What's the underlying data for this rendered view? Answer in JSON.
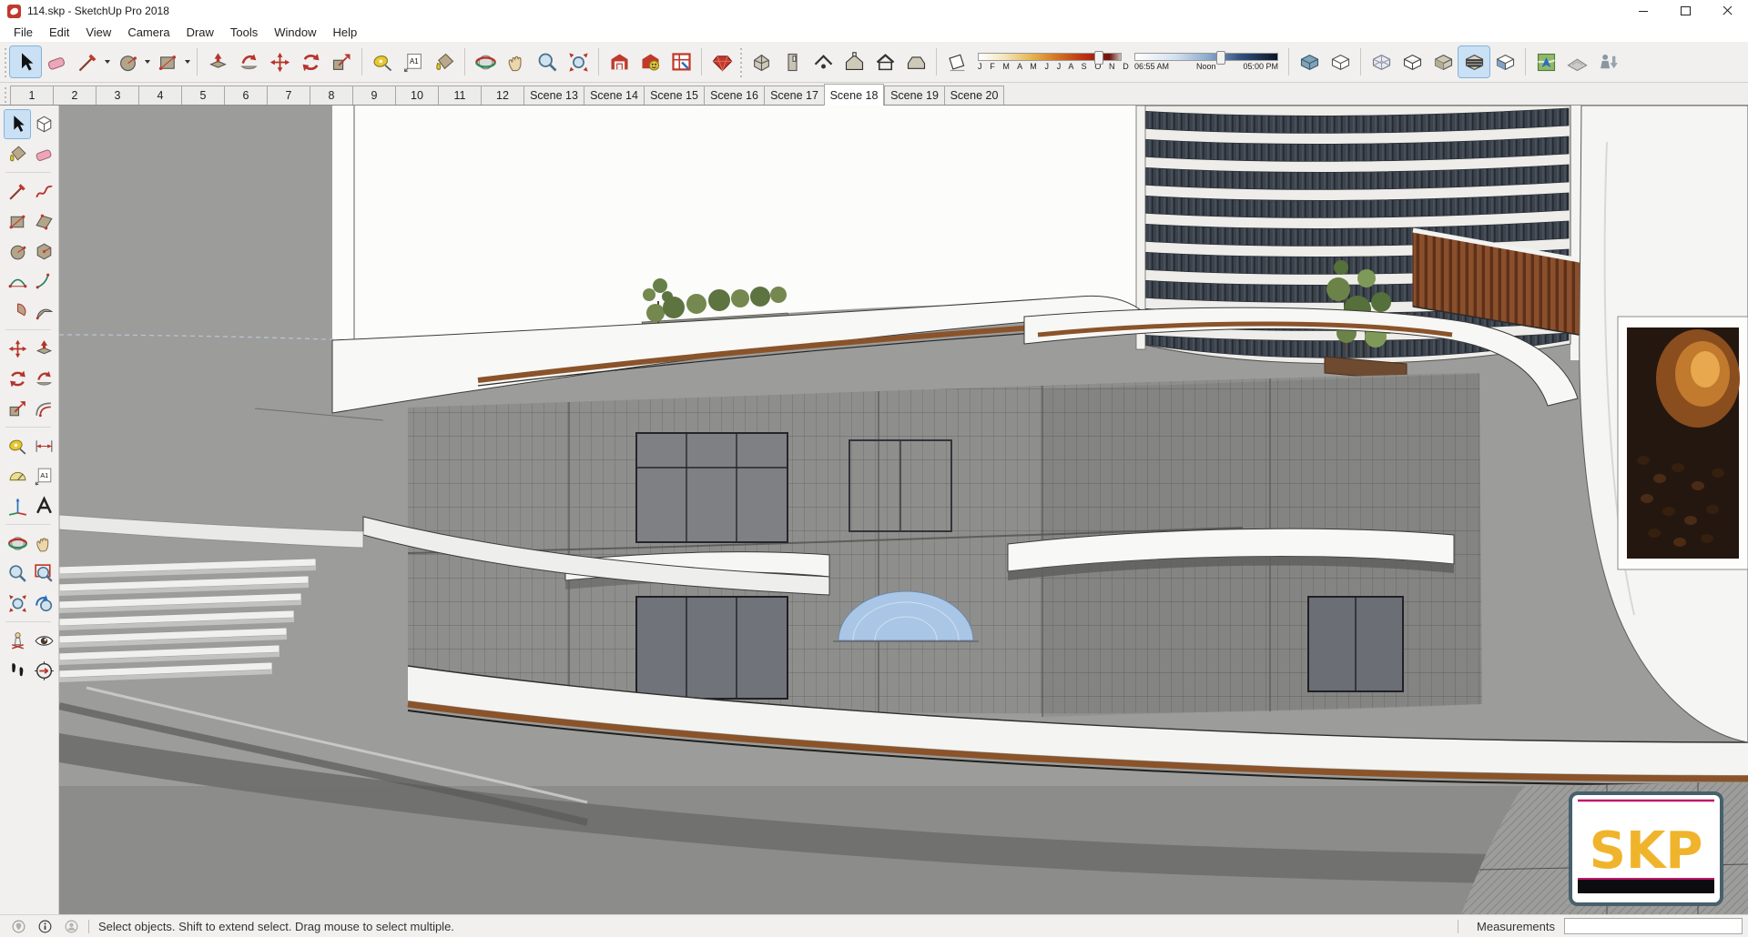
{
  "window": {
    "title": "114.skp - SketchUp Pro 2018"
  },
  "menu": {
    "items": [
      "File",
      "Edit",
      "View",
      "Camera",
      "Draw",
      "Tools",
      "Window",
      "Help"
    ]
  },
  "toolbar": {
    "text_tool_glyph": "A1",
    "shadow": {
      "months_label": "J F M A M J J A S O N D",
      "time_start": "06:55 AM",
      "time_mid": "Noon",
      "time_end": "05:00 PM"
    }
  },
  "tabs": {
    "items": [
      "1",
      "2",
      "3",
      "4",
      "5",
      "6",
      "7",
      "8",
      "9",
      "10",
      "11",
      "12",
      "Scene 13",
      "Scene 14",
      "Scene 15",
      "Scene 16",
      "Scene 17",
      "Scene 18",
      "Scene 19",
      "Scene 20"
    ],
    "active": "Scene 18"
  },
  "statusbar": {
    "hint": "Select objects. Shift to extend select. Drag mouse to select multiple.",
    "measurements_label": "Measurements",
    "measurements_value": ""
  },
  "canvas": {
    "skp_sign_text": "SKP"
  },
  "colors": {
    "selection_highlight": "#c9e0f5",
    "sketchup_red": "#c0392b",
    "sign_yellow": "#f0b42c",
    "stripe_brown": "#8a532a",
    "viewport_gray": "#9c9c9b"
  }
}
